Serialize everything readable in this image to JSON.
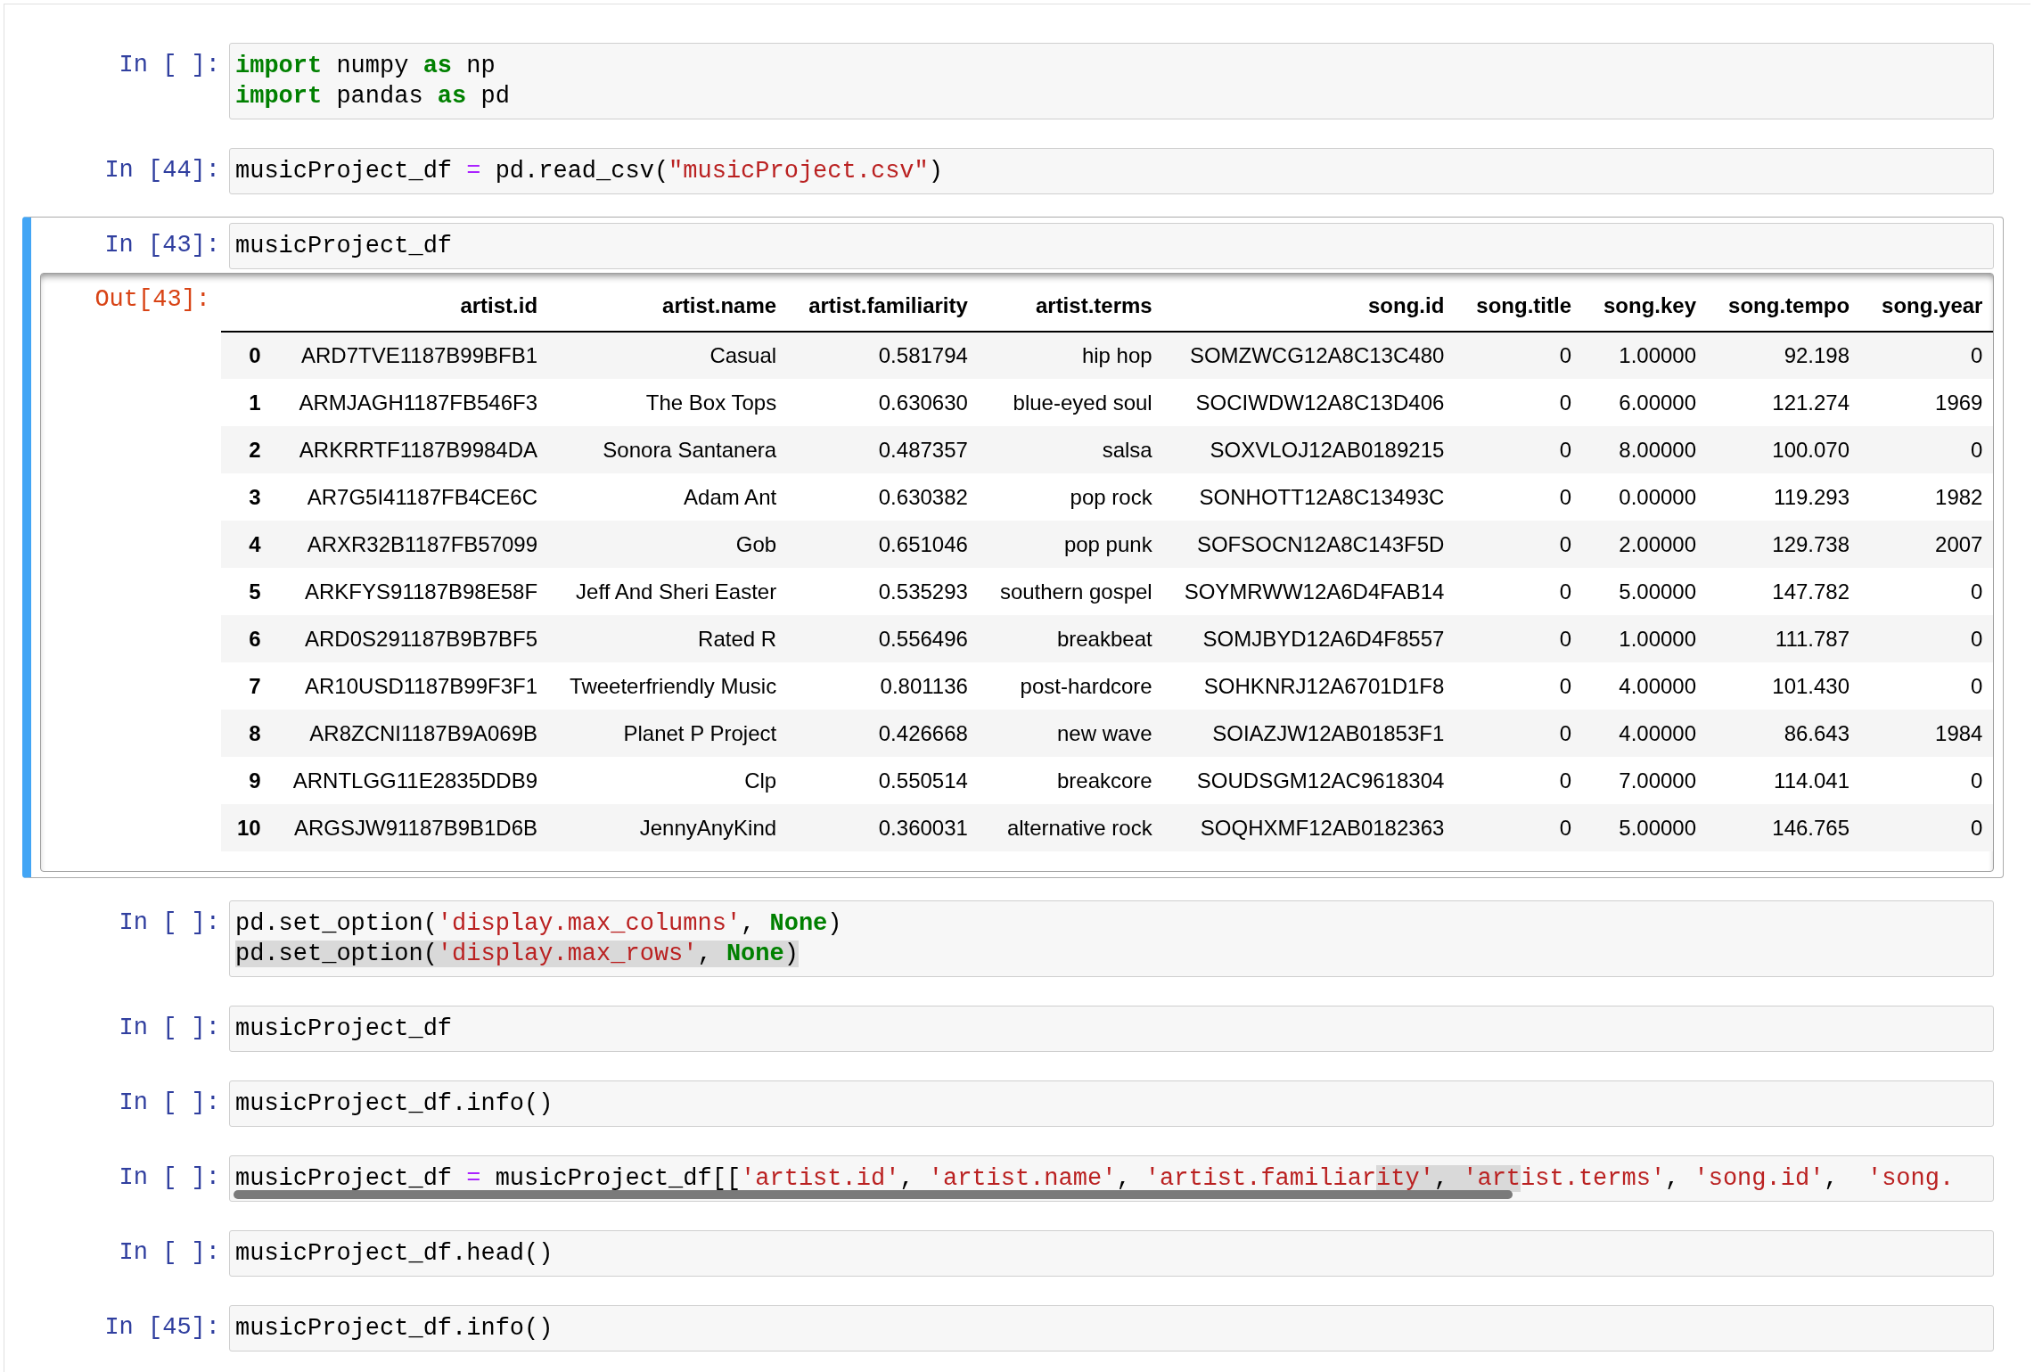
{
  "cells": [
    {
      "prompt": "In [ ]:",
      "selected": false,
      "lines": [
        [
          {
            "kind": "kw",
            "text": "import"
          },
          {
            "kind": "plain",
            "text": " numpy "
          },
          {
            "kind": "kw",
            "text": "as"
          },
          {
            "kind": "plain",
            "text": " np"
          }
        ],
        [
          {
            "kind": "kw",
            "text": "import"
          },
          {
            "kind": "plain",
            "text": " pandas "
          },
          {
            "kind": "kw",
            "text": "as"
          },
          {
            "kind": "plain",
            "text": " pd"
          }
        ]
      ]
    },
    {
      "prompt": "In [44]:",
      "selected": false,
      "lines": [
        [
          {
            "kind": "plain",
            "text": "musicProject_df "
          },
          {
            "kind": "op",
            "text": "="
          },
          {
            "kind": "plain",
            "text": " pd.read_csv("
          },
          {
            "kind": "str",
            "text": "\"musicProject.csv\""
          },
          {
            "kind": "plain",
            "text": ")"
          }
        ]
      ]
    },
    {
      "prompt": "In [43]:",
      "selected": true,
      "lines": [
        [
          {
            "kind": "plain",
            "text": "musicProject_df"
          }
        ]
      ],
      "output": {
        "prompt": "Out[43]:",
        "table": {
          "columns": [
            "artist.id",
            "artist.name",
            "artist.familiarity",
            "artist.terms",
            "song.id",
            "song.title",
            "song.key",
            "song.tempo",
            "song.year"
          ],
          "rows": [
            {
              "index": "0",
              "cells": [
                "ARD7TVE1187B99BFB1",
                "Casual",
                "0.581794",
                "hip hop",
                "SOMZWCG12A8C13C480",
                "0",
                "1.00000",
                "92.198",
                "0"
              ]
            },
            {
              "index": "1",
              "cells": [
                "ARMJAGH1187FB546F3",
                "The Box Tops",
                "0.630630",
                "blue-eyed soul",
                "SOCIWDW12A8C13D406",
                "0",
                "6.00000",
                "121.274",
                "1969"
              ]
            },
            {
              "index": "2",
              "cells": [
                "ARKRRTF1187B9984DA",
                "Sonora Santanera",
                "0.487357",
                "salsa",
                "SOXVLOJ12AB0189215",
                "0",
                "8.00000",
                "100.070",
                "0"
              ]
            },
            {
              "index": "3",
              "cells": [
                "AR7G5I41187FB4CE6C",
                "Adam Ant",
                "0.630382",
                "pop rock",
                "SONHOTT12A8C13493C",
                "0",
                "0.00000",
                "119.293",
                "1982"
              ]
            },
            {
              "index": "4",
              "cells": [
                "ARXR32B1187FB57099",
                "Gob",
                "0.651046",
                "pop punk",
                "SOFSOCN12A8C143F5D",
                "0",
                "2.00000",
                "129.738",
                "2007"
              ]
            },
            {
              "index": "5",
              "cells": [
                "ARKFYS91187B98E58F",
                "Jeff And Sheri Easter",
                "0.535293",
                "southern gospel",
                "SOYMRWW12A6D4FAB14",
                "0",
                "5.00000",
                "147.782",
                "0"
              ]
            },
            {
              "index": "6",
              "cells": [
                "ARD0S291187B9B7BF5",
                "Rated R",
                "0.556496",
                "breakbeat",
                "SOMJBYD12A6D4F8557",
                "0",
                "1.00000",
                "111.787",
                "0"
              ]
            },
            {
              "index": "7",
              "cells": [
                "AR10USD1187B99F3F1",
                "Tweeterfriendly Music",
                "0.801136",
                "post-hardcore",
                "SOHKNRJ12A6701D1F8",
                "0",
                "4.00000",
                "101.430",
                "0"
              ]
            },
            {
              "index": "8",
              "cells": [
                "AR8ZCNI1187B9A069B",
                "Planet P Project",
                "0.426668",
                "new wave",
                "SOIAZJW12AB01853F1",
                "0",
                "4.00000",
                "86.643",
                "1984"
              ]
            },
            {
              "index": "9",
              "cells": [
                "ARNTLGG11E2835DDB9",
                "Clp",
                "0.550514",
                "breakcore",
                "SOUDSGM12AC9618304",
                "0",
                "7.00000",
                "114.041",
                "0"
              ]
            },
            {
              "index": "10",
              "cells": [
                "ARGSJW91187B9B1D6B",
                "JennyAnyKind",
                "0.360031",
                "alternative rock",
                "SOQHXMF12AB0182363",
                "0",
                "5.00000",
                "146.765",
                "0"
              ]
            }
          ]
        }
      }
    },
    {
      "prompt": "In [ ]:",
      "selected": false,
      "lines": [
        [
          {
            "kind": "plain",
            "text": "pd.set_option("
          },
          {
            "kind": "str",
            "text": "'display.max_columns'"
          },
          {
            "kind": "plain",
            "text": ", "
          },
          {
            "kind": "kw",
            "text": "None"
          },
          {
            "kind": "plain",
            "text": ")"
          }
        ],
        [
          {
            "kind": "plain",
            "text": "pd.set_option(",
            "highlighted": true
          },
          {
            "kind": "str",
            "text": "'display.max_rows'",
            "highlighted": true
          },
          {
            "kind": "plain",
            "text": ", ",
            "highlighted": true
          },
          {
            "kind": "kw",
            "text": "None",
            "highlighted": true
          },
          {
            "kind": "plain",
            "text": ")",
            "highlighted": true
          }
        ]
      ]
    },
    {
      "prompt": "In [ ]:",
      "selected": false,
      "lines": [
        [
          {
            "kind": "plain",
            "text": "musicProject_df"
          }
        ]
      ]
    },
    {
      "prompt": "In [ ]:",
      "selected": false,
      "lines": [
        [
          {
            "kind": "plain",
            "text": "musicProject_df.info()"
          }
        ]
      ]
    },
    {
      "prompt": "In [ ]:",
      "selected": false,
      "scrollbar": true,
      "lines": [
        [
          {
            "kind": "plain",
            "text": "musicProject_df "
          },
          {
            "kind": "op",
            "text": "="
          },
          {
            "kind": "plain",
            "text": " musicProject_df[["
          },
          {
            "kind": "str",
            "text": "'artist.id'"
          },
          {
            "kind": "plain",
            "text": ", "
          },
          {
            "kind": "str",
            "text": "'artist.name'"
          },
          {
            "kind": "plain",
            "text": ", "
          },
          {
            "kind": "str",
            "text": "'artist.familiar"
          },
          {
            "kind": "str",
            "text": "ity'",
            "highlighted": true
          },
          {
            "kind": "plain",
            "text": ", ",
            "highlighted": true
          },
          {
            "kind": "str",
            "text": "'art",
            "highlighted": true
          },
          {
            "kind": "str",
            "text": "ist.terms'"
          },
          {
            "kind": "plain",
            "text": ", "
          },
          {
            "kind": "str",
            "text": "'song.id'"
          },
          {
            "kind": "plain",
            "text": ",  "
          },
          {
            "kind": "str",
            "text": "'song."
          }
        ]
      ]
    },
    {
      "prompt": "In [ ]:",
      "selected": false,
      "lines": [
        [
          {
            "kind": "plain",
            "text": "musicProject_df.head()"
          }
        ]
      ]
    },
    {
      "prompt": "In [45]:",
      "selected": false,
      "lines": [
        [
          {
            "kind": "plain",
            "text": "musicProject_df.info()"
          }
        ]
      ]
    }
  ]
}
